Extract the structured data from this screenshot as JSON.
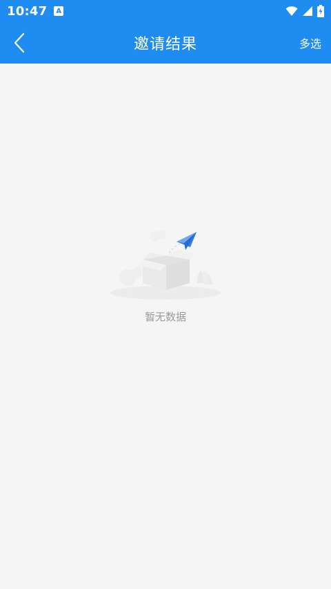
{
  "status_bar": {
    "time": "10:47",
    "notification_icon": "a-badge-icon",
    "wifi_icon": "wifi-icon",
    "signal_icon": "cellular-signal-icon",
    "battery_icon": "battery-charging-icon"
  },
  "app_bar": {
    "title": "邀请结果",
    "back_icon": "chevron-left-icon",
    "action_label": "多选"
  },
  "empty_state": {
    "message": "暂无数据",
    "illustration": "empty-box-with-paper-plane"
  },
  "colors": {
    "primary": "#1f8cf1",
    "background": "#f5f5f5",
    "muted_text": "#9a9a9a"
  }
}
